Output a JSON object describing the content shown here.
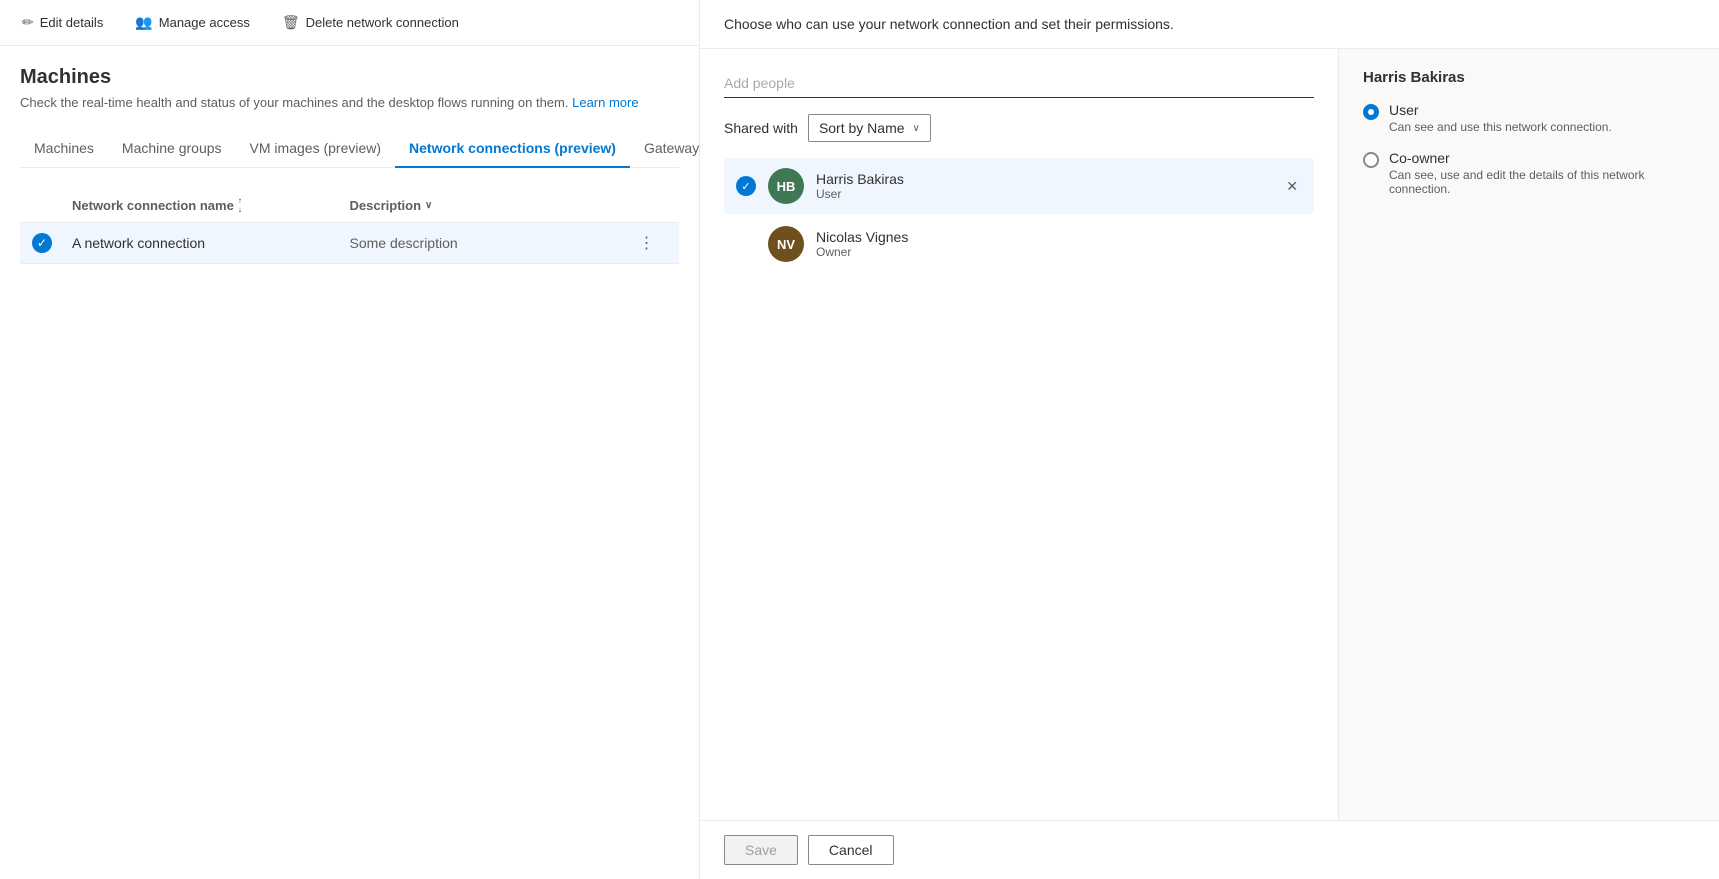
{
  "toolbar": {
    "edit_label": "Edit details",
    "manage_label": "Manage access",
    "delete_label": "Delete network connection",
    "edit_icon": "✏",
    "manage_icon": "👥",
    "delete_icon": "🗑"
  },
  "page": {
    "title": "Machines",
    "subtitle": "Check the real-time health and status of your machines and the desktop flows running on them.",
    "learn_more": "Learn more"
  },
  "tabs": [
    {
      "id": "machines",
      "label": "Machines",
      "active": false
    },
    {
      "id": "machine-groups",
      "label": "Machine groups",
      "active": false
    },
    {
      "id": "vm-images",
      "label": "VM images (preview)",
      "active": false
    },
    {
      "id": "network-connections",
      "label": "Network connections (preview)",
      "active": true
    },
    {
      "id": "gateways",
      "label": "Gateways",
      "active": false
    }
  ],
  "table": {
    "col_name": "Network connection name",
    "col_desc": "Description",
    "rows": [
      {
        "name": "A network connection",
        "description": "Some description",
        "selected": true
      }
    ]
  },
  "panel": {
    "intro": "Choose who can use your network connection and set their permissions.",
    "add_people_placeholder": "Add people",
    "shared_with_label": "Shared with",
    "sort_by": "Sort by Name",
    "users": [
      {
        "id": "hb",
        "name": "Harris Bakiras",
        "role": "User",
        "initials": "HB",
        "avatar_color": "#407855",
        "selected": true
      },
      {
        "id": "nv",
        "name": "Nicolas Vignes",
        "role": "Owner",
        "initials": "NV",
        "avatar_color": "#6e4f1e",
        "selected": false
      }
    ]
  },
  "permissions": {
    "user_name": "Harris Bakiras",
    "options": [
      {
        "id": "user",
        "label": "User",
        "description": "Can see and use this network connection.",
        "checked": true
      },
      {
        "id": "co-owner",
        "label": "Co-owner",
        "description": "Can see, use and edit the details of this network connection.",
        "checked": false
      }
    ]
  },
  "footer": {
    "save_label": "Save",
    "cancel_label": "Cancel"
  }
}
